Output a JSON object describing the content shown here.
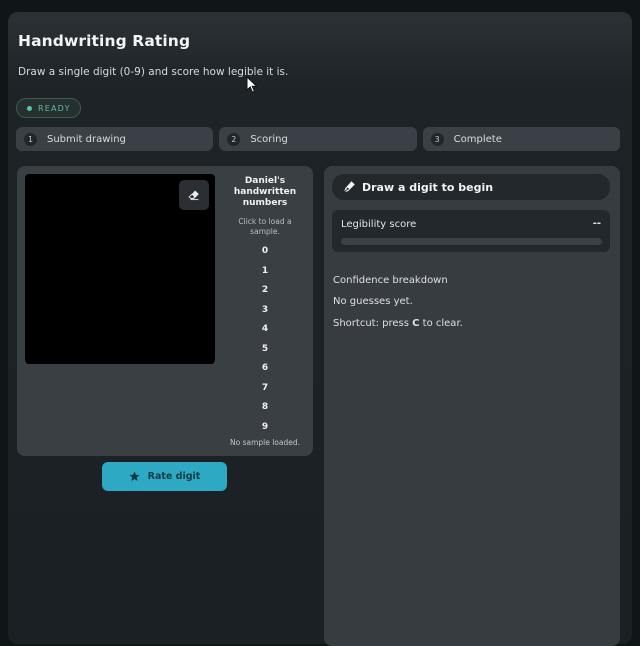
{
  "header": {
    "title": "Handwriting Rating",
    "subtitle": "Draw a single digit (0-9) and score how legible it is."
  },
  "status_badge": "READY",
  "steps": [
    {
      "num": "1",
      "label": "Submit drawing"
    },
    {
      "num": "2",
      "label": "Scoring"
    },
    {
      "num": "3",
      "label": "Complete"
    }
  ],
  "samples": {
    "title": "Daniel's handwritten numbers",
    "hint": "Click to load a sample.",
    "digits": [
      "0",
      "1",
      "2",
      "3",
      "4",
      "5",
      "6",
      "7",
      "8",
      "9"
    ],
    "status": "No sample loaded."
  },
  "rate_button": "Rate digit",
  "result": {
    "prompt": "Draw a digit to begin",
    "score_label": "Legibility score",
    "score_value": "--",
    "score_fraction": 0,
    "confidence_label": "Confidence breakdown",
    "guesses_text": "No guesses yet.",
    "shortcut_prefix": "Shortcut: press ",
    "shortcut_key": "C",
    "shortcut_suffix": " to clear."
  },
  "icons": {
    "eraser": "eraser-icon",
    "star": "star-icon",
    "pen": "pen-icon"
  },
  "colors": {
    "accent": "#2ea9c4",
    "ready": "#52c7a5"
  }
}
